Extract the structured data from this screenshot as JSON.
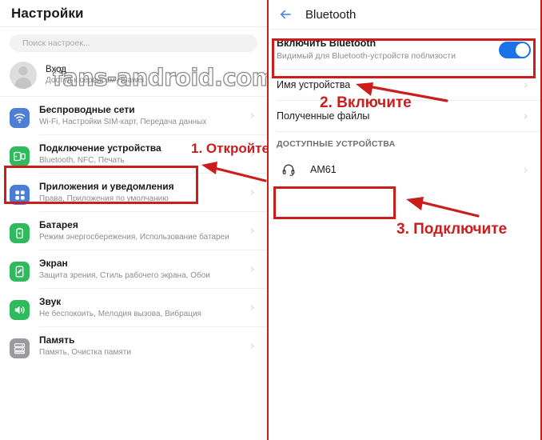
{
  "left_panel": {
    "header_title": "Настройки",
    "search": {
      "placeholder": "Поиск настроек..."
    },
    "account": {
      "title": "Вход",
      "subtitle": "Доступ к сервисам Huawei"
    },
    "watermark": "fans-android.com",
    "items": [
      {
        "title": "Беспроводные сети",
        "subtitle": "Wi-Fi, Настройки SIM-карт, Передача данных",
        "icon": "wifi-icon",
        "icon_color": "#4f7fd4"
      },
      {
        "title": "Подключение устройства",
        "subtitle": "Bluetooth, NFC, Печать",
        "icon": "device-connection-icon",
        "icon_color": "#2fbb5d"
      },
      {
        "title": "Приложения и уведомления",
        "subtitle": "Права, Приложения по умолчанию",
        "icon": "apps-grid-icon",
        "icon_color": "#4a7ed6"
      },
      {
        "title": "Батарея",
        "subtitle": "Режим энергосбережения, Использование батареи",
        "icon": "battery-icon",
        "icon_color": "#2fbb5d"
      },
      {
        "title": "Экран",
        "subtitle": "Защита зрения, Стиль рабочего экрана, Обои",
        "icon": "display-icon",
        "icon_color": "#2fbb5d"
      },
      {
        "title": "Звук",
        "subtitle": "Не беспокоить, Мелодия вызова, Вибрация",
        "icon": "sound-speaker-icon",
        "icon_color": "#2fbb5d"
      },
      {
        "title": "Память",
        "subtitle": "Память, Очистка памяти",
        "icon": "storage-icon",
        "icon_color": "#9a9a9f"
      }
    ]
  },
  "right_panel": {
    "header_title": "Bluetooth",
    "back_icon": "back-arrow-icon",
    "toggle": {
      "title": "Включить Bluetooth",
      "subtitle": "Видимый для Bluetooth-устройств поблизости",
      "state": "on",
      "color": "#1a73e8"
    },
    "rows": [
      {
        "label": "Имя устройства"
      },
      {
        "label": "Полученные файлы"
      }
    ],
    "section_header": "ДОСТУПНЫЕ УСТРОЙСТВА",
    "devices": [
      {
        "name": "AM61",
        "icon": "headset-icon"
      }
    ]
  },
  "annotations": {
    "color": "#cc1d1d",
    "step1": "1. Откройте",
    "step2": "2. Включите",
    "step3": "3. Подключите"
  }
}
